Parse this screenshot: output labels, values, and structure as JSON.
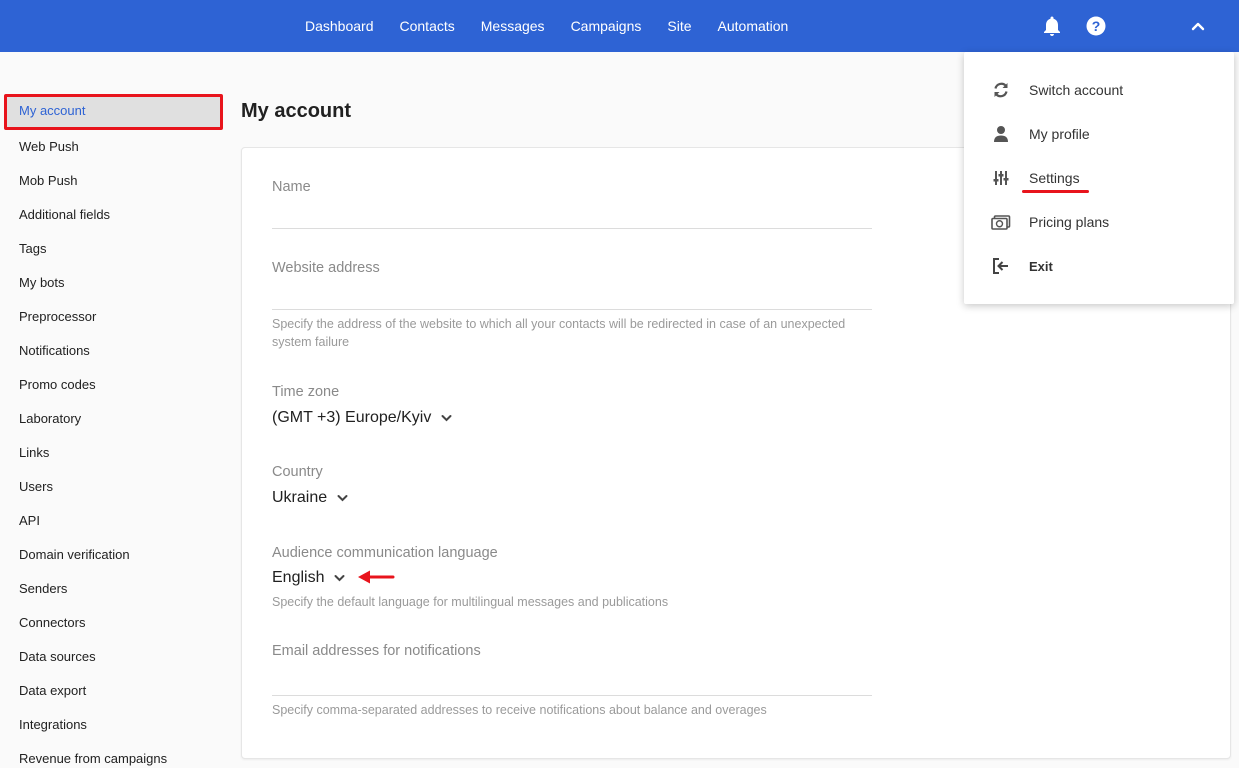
{
  "nav": {
    "items": [
      "Dashboard",
      "Contacts",
      "Messages",
      "Campaigns",
      "Site",
      "Automation"
    ]
  },
  "icons": {
    "bell": "bell-icon",
    "help": "help-icon",
    "collapse": "chevron-up-icon"
  },
  "sidebar": {
    "items": [
      "My account",
      "Web Push",
      "Mob Push",
      "Additional fields",
      "Tags",
      "My bots",
      "Preprocessor",
      "Notifications",
      "Promo codes",
      "Laboratory",
      "Links",
      "Users",
      "API",
      "Domain verification",
      "Senders",
      "Connectors",
      "Data sources",
      "Data export",
      "Integrations",
      "Revenue from campaigns"
    ],
    "active_index": 0
  },
  "page": {
    "title": "My account"
  },
  "form": {
    "name_label": "Name",
    "website_label": "Website address",
    "website_hint": "Specify the address of the website to which all your contacts will be redirected in case of an unexpected system failure",
    "timezone_label": "Time zone",
    "timezone_value": "(GMT +3) Europe/Kyiv",
    "country_label": "Country",
    "country_value": "Ukraine",
    "language_label": "Audience communication language",
    "language_value": "English",
    "language_hint": "Specify the default language for multilingual messages and publications",
    "emails_label": "Email addresses for notifications",
    "emails_hint": "Specify comma-separated addresses to receive notifications about balance and overages"
  },
  "menu": {
    "items": [
      {
        "label": "Switch account",
        "icon": "switch-icon"
      },
      {
        "label": "My profile",
        "icon": "person-icon"
      },
      {
        "label": "Settings",
        "icon": "sliders-icon"
      },
      {
        "label": "Pricing plans",
        "icon": "money-icon"
      },
      {
        "label": "Exit",
        "icon": "exit-icon"
      }
    ]
  },
  "colors": {
    "header": "#2e63d4",
    "highlight": "#e8141c"
  }
}
